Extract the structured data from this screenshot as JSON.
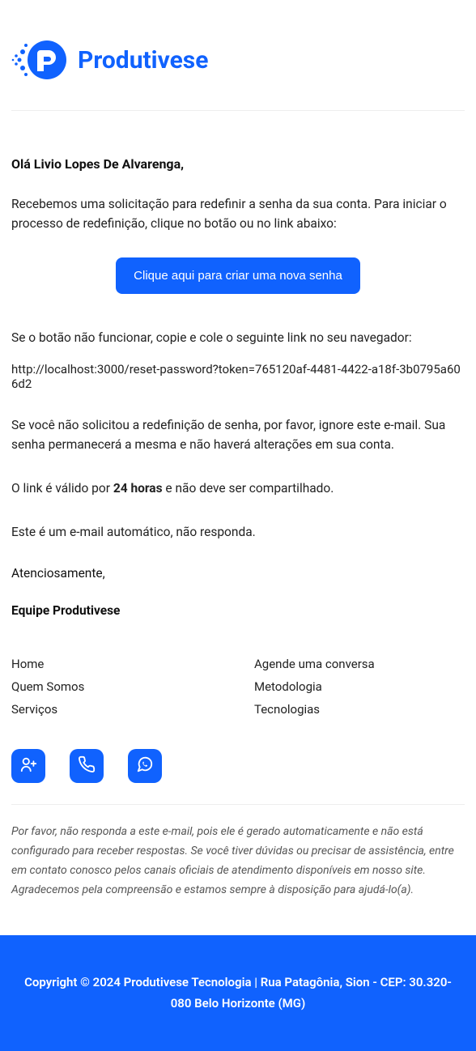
{
  "brand": "Produtivese",
  "greeting": "Olá Livio Lopes De Alvarenga,",
  "intro": "Recebemos uma solicitação para redefinir a senha da sua conta. Para iniciar o processo de redefinição, clique no botão ou no link abaixo:",
  "button_label": "Clique aqui para criar uma nova senha",
  "fallback_text": "Se o botão não funcionar, copie e cole o seguinte link no seu navegador:",
  "reset_url": "http://localhost:3000/reset-password?token=765120af-4481-4422-a18f-3b0795a606d2",
  "ignore_text": "Se você não solicitou a redefinição de senha, por favor, ignore este e-mail. Sua senha permanecerá a mesma e não haverá alterações em sua conta.",
  "validity_prefix": "O link é válido por ",
  "validity_bold": "24 horas",
  "validity_suffix": " e não deve ser compartilhado.",
  "auto_email": "Este é um e-mail automático, não responda.",
  "signoff": "Atenciosamente,",
  "team": "Equipe Produtivese",
  "links_col1": [
    "Home",
    "Quem Somos",
    "Serviços"
  ],
  "links_col2": [
    "Agende uma conversa",
    "Metodologia",
    "Tecnologias"
  ],
  "disclaimer": "Por favor, não responda a este e-mail, pois ele é gerado automaticamente e não está configurado para receber respostas. Se você tiver dúvidas ou precisar de assistência, entre em contato conosco pelos canais oficiais de atendimento disponíveis em nosso site. Agradecemos pela compreensão e estamos sempre à disposição para ajudá-lo(a).",
  "footer": "Copyright © 2024 Produtivese Tecnologia | Rua Patagônia, Sion - CEP: 30.320-080 Belo Horizonte (MG)"
}
